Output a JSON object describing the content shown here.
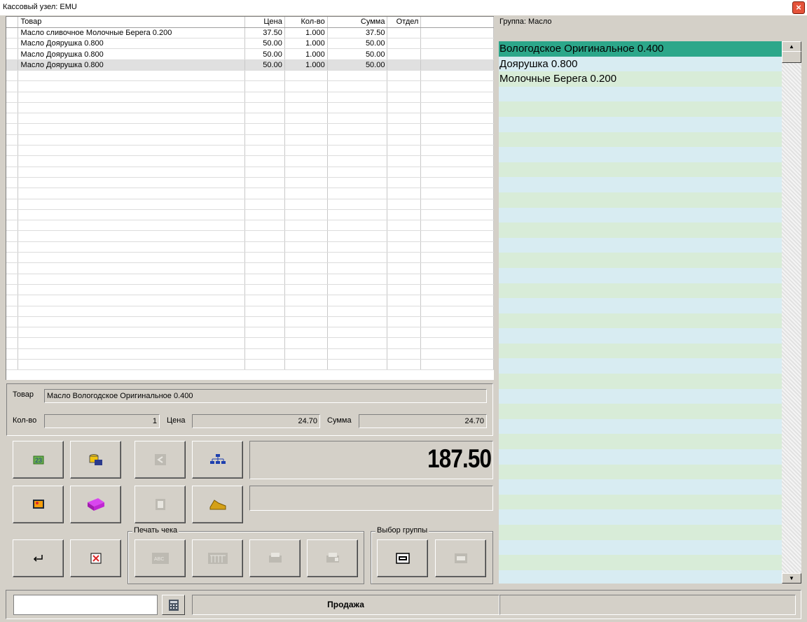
{
  "window": {
    "title": "Кассовый узел: EMU",
    "close": "×"
  },
  "grid": {
    "columns": [
      "Товар",
      "Цена",
      "Кол-во",
      "Сумма",
      "Отдел"
    ],
    "rows": [
      [
        "Масло сливочное Молочные Берега 0.200",
        "37.50",
        "1.000",
        "37.50",
        ""
      ],
      [
        "Масло Доярушка 0.800",
        "50.00",
        "1.000",
        "50.00",
        ""
      ],
      [
        "Масло Доярушка 0.800",
        "50.00",
        "1.000",
        "50.00",
        ""
      ],
      [
        "Масло Доярушка 0.800",
        "50.00",
        "1.000",
        "50.00",
        ""
      ]
    ]
  },
  "details": {
    "item_label": "Товар",
    "item_value": "Масло Вологодское Оригинальное 0.400",
    "qty_label": "Кол-во",
    "qty_value": "1",
    "price_label": "Цена",
    "price_value": "24.70",
    "sum_label": "Сумма",
    "sum_value": "24.70"
  },
  "total": "187.50",
  "print_group_label": "Печать чека",
  "select_group_label": "Выбор группы",
  "right": {
    "group_label": "Группа: Масло",
    "items": [
      "Вологодское Оригинальное 0.400",
      "Доярушка 0.800",
      "Молочные Берега 0.200"
    ],
    "scroll_up": "▲",
    "scroll_down": "▼"
  },
  "status": {
    "mode": "Продажа",
    "input_value": "",
    "extra": ""
  },
  "colors": {
    "selected_item": "#2ca78a",
    "row_odd": "#d8ecd8",
    "row_even": "#d8ecf2"
  }
}
